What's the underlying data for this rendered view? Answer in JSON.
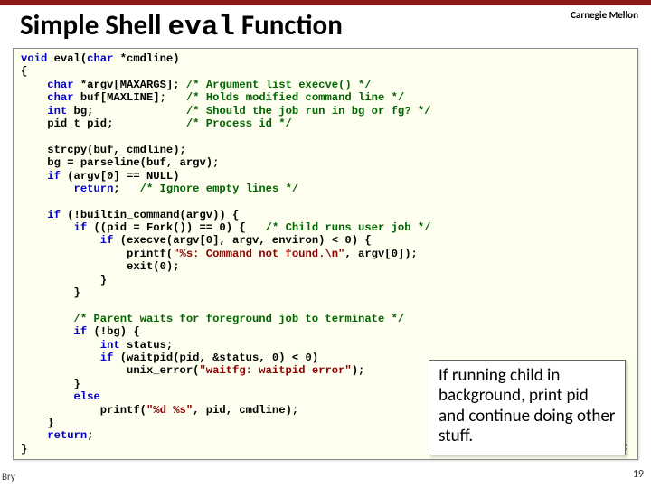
{
  "branding": "Carnegie Mellon",
  "title_pre": "Simple Shell ",
  "title_mono": "eval",
  "title_post": " Function",
  "code_html": "<span class=\"kw\">void</span> eval(<span class=\"kw\">char</span> *cmdline)\n{\n    <span class=\"kw\">char</span> *argv[MAXARGS]; <span class=\"cmt\">/* Argument list execve() */</span>\n    <span class=\"kw\">char</span> buf[MAXLINE];   <span class=\"cmt\">/* Holds modified command line */</span>\n    <span class=\"kw\">int</span> bg;              <span class=\"cmt\">/* Should the job run in bg or fg? */</span>\n    pid_t pid;           <span class=\"cmt\">/* Process id */</span>\n\n    strcpy(buf, cmdline);\n    bg = parseline(buf, argv);\n    <span class=\"kw\">if</span> (argv[0] == NULL)\n        <span class=\"kw\">return</span>;   <span class=\"cmt\">/* Ignore empty lines */</span>\n\n    <span class=\"kw\">if</span> (!builtin_command(argv)) {\n        <span class=\"kw\">if</span> ((pid = Fork()) == 0) {   <span class=\"cmt\">/* Child runs user job */</span>\n            <span class=\"kw\">if</span> (execve(argv[0], argv, environ) &lt; 0) {\n                printf(<span class=\"str\">\"%s: Command not found.\\n\"</span>, argv[0]);\n                exit(0);\n            }\n        }\n\n        <span class=\"cmt\">/* Parent waits for foreground job to terminate */</span>\n        <span class=\"kw\">if</span> (!bg) {\n            <span class=\"kw\">int</span> status;\n            <span class=\"kw\">if</span> (waitpid(pid, &amp;status, 0) &lt; 0)\n                unix_error(<span class=\"str\">\"waitfg: waitpid error\"</span>);\n        }\n        <span class=\"kw\">else</span>\n            printf(<span class=\"str\">\"%d %s\"</span>, pid, cmdline);\n    }\n    <span class=\"kw\">return</span>;\n}",
  "source_file": "shellex.c",
  "annotation": "If running child in background, print pid and continue doing other stuff.",
  "page_num": "19",
  "credit": "Bry"
}
